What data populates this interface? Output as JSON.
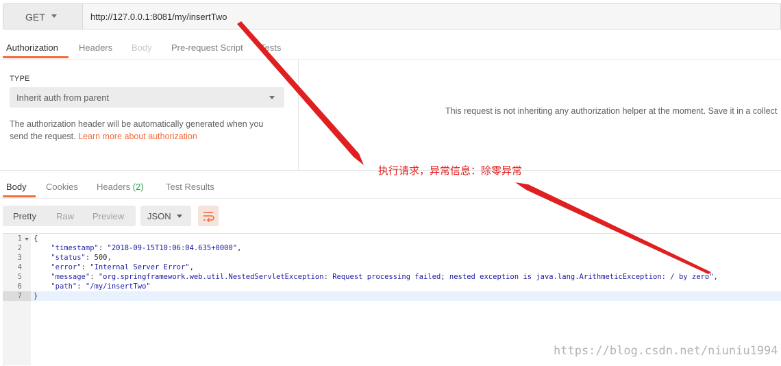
{
  "request": {
    "method": "GET",
    "url": "http://127.0.0.1:8081/my/insertTwo"
  },
  "request_tabs": [
    "Authorization",
    "Headers",
    "Body",
    "Pre-request Script",
    "Tests"
  ],
  "auth": {
    "type_label": "TYPE",
    "selected": "Inherit auth from parent",
    "description": "The authorization header will be automatically generated when you send the request.",
    "link_text": "Learn more about authorization",
    "right_message": "This request is not inheriting any authorization helper at the moment. Save it in a collect"
  },
  "response_tabs": {
    "body": "Body",
    "cookies": "Cookies",
    "headers": "Headers",
    "headers_count": "(2)",
    "test_results": "Test Results"
  },
  "view": {
    "modes": [
      "Pretty",
      "Raw",
      "Preview"
    ],
    "active_mode": "Pretty",
    "format": "JSON"
  },
  "response_body": {
    "line_numbers": [
      "1",
      "2",
      "3",
      "4",
      "5",
      "6",
      "7"
    ],
    "open_brace": "{",
    "close_brace": "}",
    "timestamp_key": "\"timestamp\"",
    "timestamp_value": "\"2018-09-15T10:06:04.635+0000\"",
    "status_key": "\"status\"",
    "status_value": "500",
    "error_key": "\"error\"",
    "error_value": "\"Internal Server Error\"",
    "message_key": "\"message\"",
    "message_value": "\"org.springframework.web.util.NestedServletException: Request processing failed; nested exception is java.lang.ArithmeticException: / by zero\"",
    "path_key": "\"path\"",
    "path_value": "\"/my/insertTwo\""
  },
  "annotation": "执行请求，异常信息：除零异常",
  "watermark": "https://blog.csdn.net/niuniu1994",
  "colors": {
    "accent": "#f26b3a",
    "annotation": "#e02020",
    "badge": "#28a745"
  }
}
